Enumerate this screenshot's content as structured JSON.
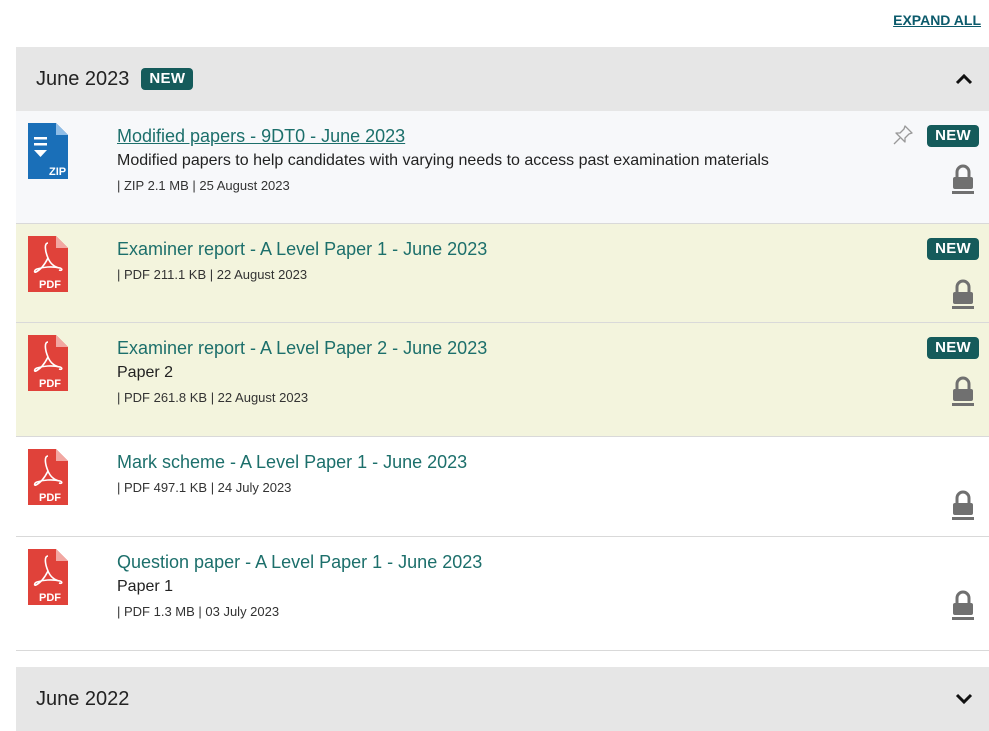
{
  "expand_all": "EXPAND ALL",
  "groups": [
    {
      "title": "June 2023",
      "badge": "NEW",
      "expanded": true,
      "items": [
        {
          "type": "ZIP",
          "title": "Modified papers - 9DT0 - June 2023",
          "desc": "Modified papers to help candidates with varying needs to access past examination materials",
          "meta": "| ZIP 2.1 MB | 25 August 2023",
          "badge": "NEW",
          "pinned": true
        },
        {
          "type": "PDF",
          "title": "Examiner report - A Level Paper 1 - June 2023",
          "desc": "",
          "meta": "| PDF 211.1 KB | 22 August 2023",
          "badge": "NEW"
        },
        {
          "type": "PDF",
          "title": "Examiner report - A Level Paper 2 - June 2023",
          "desc": "Paper 2",
          "meta": "| PDF 261.8 KB | 22 August 2023",
          "badge": "NEW"
        },
        {
          "type": "PDF",
          "title": "Mark scheme - A Level Paper 1 - June 2023",
          "desc": "",
          "meta": "| PDF 497.1 KB | 24 July 2023",
          "badge": ""
        },
        {
          "type": "PDF",
          "title": "Question paper - A Level Paper 1 - June 2023",
          "desc": "Paper 1",
          "meta": "| PDF 1.3 MB | 03 July 2023",
          "badge": ""
        }
      ]
    },
    {
      "title": "June 2022",
      "badge": "",
      "expanded": false,
      "items": []
    }
  ],
  "colors": {
    "accent": "#155b5b",
    "link": "#1c6f6b",
    "pdf": "#e0423a",
    "zip": "#1a6fb8",
    "highlight": "#f3f4dd"
  }
}
